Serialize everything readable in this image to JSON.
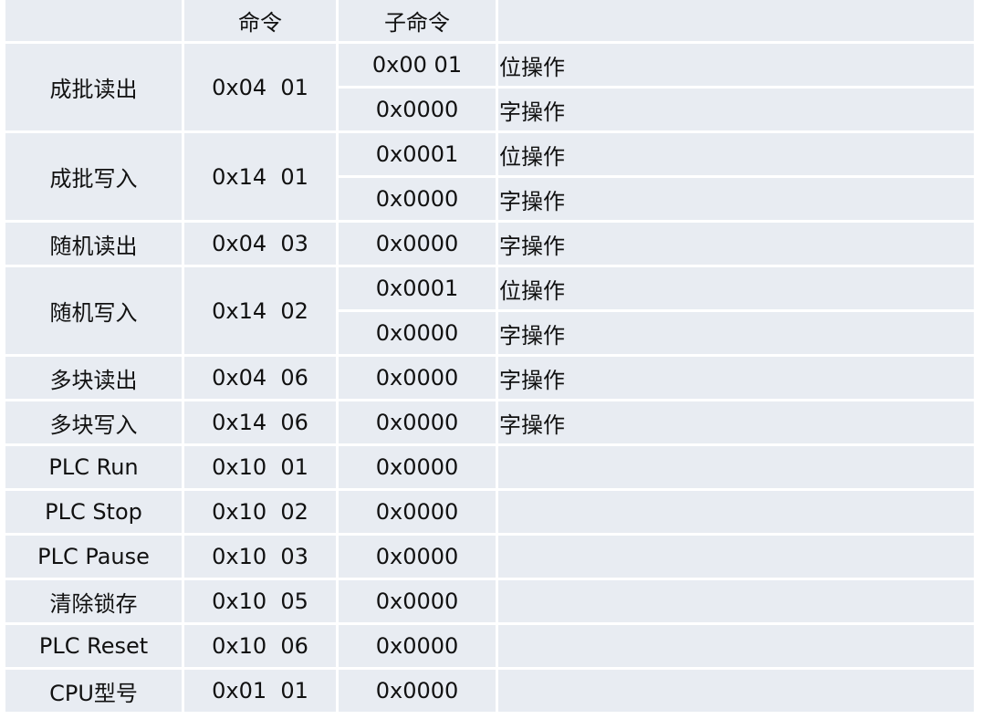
{
  "table": {
    "headers": [
      "",
      "命令",
      "子命令",
      ""
    ],
    "rows": [
      {
        "name": "成批读出",
        "cmd": "0x04  01",
        "subs": [
          {
            "sub": "0x00 01",
            "note": "位操作"
          },
          {
            "sub": "0x0000",
            "note": "字操作"
          }
        ]
      },
      {
        "name": "成批写入",
        "cmd": "0x14  01",
        "subs": [
          {
            "sub": "0x0001",
            "note": "位操作"
          },
          {
            "sub": "0x0000",
            "note": "字操作"
          }
        ]
      },
      {
        "name": "随机读出",
        "cmd": "0x04  03",
        "subs": [
          {
            "sub": "0x0000",
            "note": "字操作"
          }
        ]
      },
      {
        "name": "随机写入",
        "cmd": "0x14  02",
        "subs": [
          {
            "sub": "0x0001",
            "note": "位操作"
          },
          {
            "sub": "0x0000",
            "note": "字操作"
          }
        ]
      },
      {
        "name": "多块读出",
        "cmd": "0x04  06",
        "subs": [
          {
            "sub": "0x0000",
            "note": "字操作"
          }
        ]
      },
      {
        "name": "多块写入",
        "cmd": "0x14  06",
        "subs": [
          {
            "sub": "0x0000",
            "note": "字操作"
          }
        ]
      },
      {
        "name": "PLC Run",
        "cmd": "0x10  01",
        "subs": [
          {
            "sub": "0x0000",
            "note": ""
          }
        ]
      },
      {
        "name": "PLC Stop",
        "cmd": "0x10  02",
        "subs": [
          {
            "sub": "0x0000",
            "note": ""
          }
        ]
      },
      {
        "name": "PLC Pause",
        "cmd": "0x10  03",
        "subs": [
          {
            "sub": "0x0000",
            "note": ""
          }
        ]
      },
      {
        "name": "清除锁存",
        "cmd": "0x10  05",
        "subs": [
          {
            "sub": "0x0000",
            "note": ""
          }
        ]
      },
      {
        "name": "PLC Reset",
        "cmd": "0x10  06",
        "subs": [
          {
            "sub": "0x0000",
            "note": ""
          }
        ]
      },
      {
        "name": "CPU型号",
        "cmd": "0x01  01",
        "subs": [
          {
            "sub": "0x0000",
            "note": ""
          }
        ]
      }
    ]
  }
}
